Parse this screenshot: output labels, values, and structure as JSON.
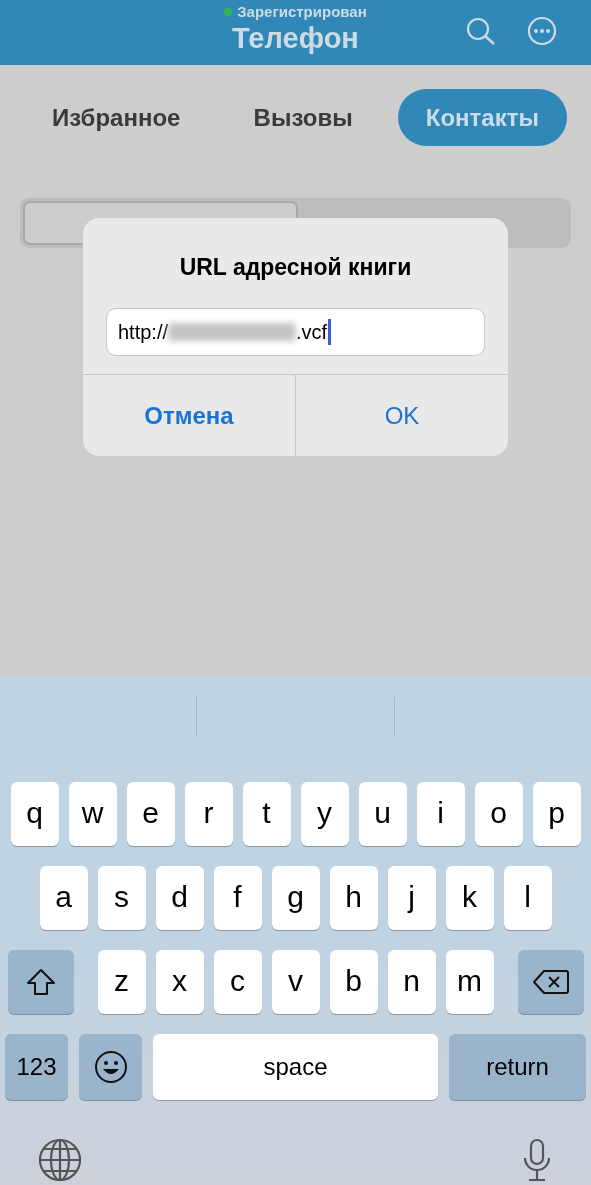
{
  "header": {
    "status": {
      "text": "Зарегистрирован",
      "online": true
    },
    "title": "Телефон"
  },
  "tabs": [
    {
      "label": "Избранное",
      "selected": false
    },
    {
      "label": "Вызовы",
      "selected": false
    },
    {
      "label": "Контакты",
      "selected": true
    }
  ],
  "segments": [
    {
      "selected": true
    },
    {
      "selected": false
    }
  ],
  "dialog": {
    "title": "URL адресной книги",
    "field": {
      "value_start": "http://",
      "value_end": ".vcf"
    },
    "buttons": [
      {
        "label": "Отмена",
        "kind": "cancel"
      },
      {
        "label": "OK",
        "kind": "default"
      }
    ]
  },
  "keyboard": {
    "rows": [
      {
        "keys": [
          {
            "label": "q",
            "kind": "letter"
          },
          {
            "label": "w",
            "kind": "letter"
          },
          {
            "label": "e",
            "kind": "letter"
          },
          {
            "label": "r",
            "kind": "letter"
          },
          {
            "label": "t",
            "kind": "letter"
          },
          {
            "label": "y",
            "kind": "letter"
          },
          {
            "label": "u",
            "kind": "letter"
          },
          {
            "label": "i",
            "kind": "letter"
          },
          {
            "label": "o",
            "kind": "letter"
          },
          {
            "label": "p",
            "kind": "letter"
          }
        ]
      },
      {
        "keys": [
          {
            "label": "a",
            "kind": "letter"
          },
          {
            "label": "s",
            "kind": "letter"
          },
          {
            "label": "d",
            "kind": "letter"
          },
          {
            "label": "f",
            "kind": "letter"
          },
          {
            "label": "g",
            "kind": "letter"
          },
          {
            "label": "h",
            "kind": "letter"
          },
          {
            "label": "j",
            "kind": "letter"
          },
          {
            "label": "k",
            "kind": "letter"
          },
          {
            "label": "l",
            "kind": "letter"
          }
        ]
      },
      {
        "keys": [
          {
            "kind": "shift"
          },
          {
            "label": "z",
            "kind": "letter"
          },
          {
            "label": "x",
            "kind": "letter"
          },
          {
            "label": "c",
            "kind": "letter"
          },
          {
            "label": "v",
            "kind": "letter"
          },
          {
            "label": "b",
            "kind": "letter"
          },
          {
            "label": "n",
            "kind": "letter"
          },
          {
            "label": "m",
            "kind": "letter"
          },
          {
            "kind": "delete"
          }
        ]
      },
      {
        "keys": [
          {
            "label": "123",
            "kind": "mode"
          },
          {
            "kind": "emoji"
          },
          {
            "label": "space",
            "kind": "space"
          },
          {
            "label": "return",
            "kind": "return"
          }
        ]
      }
    ]
  }
}
